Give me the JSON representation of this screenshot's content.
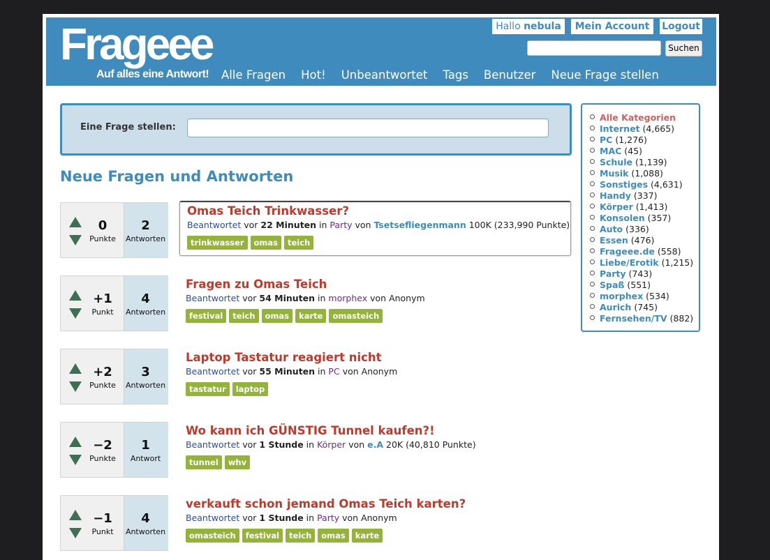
{
  "header": {
    "logo": "Frageee",
    "tagline": "Auf alles eine Antwort!",
    "greeting_prefix": "Hallo",
    "username": "nebula",
    "account_label": "Mein Account",
    "logout_label": "Logout",
    "search_button": "Suchen",
    "search_value": "",
    "nav": [
      "Alle Fragen",
      "Hot!",
      "Unbeantwortet",
      "Tags",
      "Benutzer",
      "Neue Frage stellen"
    ]
  },
  "ask": {
    "label": "Eine Frage stellen:",
    "value": ""
  },
  "section_title": "Neue Fragen und Antworten",
  "questions": [
    {
      "votes": "0",
      "votes_label": "Punkte",
      "answers": "2",
      "answers_label": "Antworten",
      "title": "Omas Teich Trinkwasser?",
      "status": "Beantwortet",
      "vor": "vor",
      "time": "22 Minuten",
      "in": "in",
      "category": "Party",
      "von": "von",
      "user": "Tsetsefliegenmann",
      "user_points": "100K (233,990 Punkte)",
      "tags": [
        "trinkwasser",
        "omas",
        "teich"
      ]
    },
    {
      "votes": "+1",
      "votes_label": "Punkt",
      "answers": "4",
      "answers_label": "Antworten",
      "title": "Fragen zu Omas Teich",
      "status": "Beantwortet",
      "vor": "vor",
      "time": "54 Minuten",
      "in": "in",
      "category": "morphex",
      "von": "von",
      "user": "",
      "user_points": "Anonym",
      "tags": [
        "festival",
        "teich",
        "omas",
        "karte",
        "omasteich"
      ]
    },
    {
      "votes": "+2",
      "votes_label": "Punkte",
      "answers": "3",
      "answers_label": "Antworten",
      "title": "Laptop Tastatur reagiert nicht",
      "status": "Beantwortet",
      "vor": "vor",
      "time": "55 Minuten",
      "in": "in",
      "category": "PC",
      "von": "von",
      "user": "",
      "user_points": "Anonym",
      "tags": [
        "tastatur",
        "laptop"
      ]
    },
    {
      "votes": "−2",
      "votes_label": "Punkte",
      "answers": "1",
      "answers_label": "Antwort",
      "title": "Wo kann ich GÜNSTIG Tunnel kaufen?!",
      "status": "Beantwortet",
      "vor": "vor",
      "time": "1 Stunde",
      "in": "in",
      "category": "Körper",
      "von": "von",
      "user": "e.A",
      "user_points": "20K (40,810 Punkte)",
      "tags": [
        "tunnel",
        "whv"
      ]
    },
    {
      "votes": "−1",
      "votes_label": "Punkt",
      "answers": "4",
      "answers_label": "Antworten",
      "title": "verkauft schon jemand Omas Teich karten?",
      "status": "Beantwortet",
      "vor": "vor",
      "time": "1 Stunde",
      "in": "in",
      "category": "Party",
      "von": "von",
      "user": "",
      "user_points": "Anonym",
      "tags": [
        "omasteich",
        "festival",
        "teich",
        "omas",
        "karte"
      ]
    }
  ],
  "categories": [
    {
      "name": "Alle Kategorien",
      "count": ""
    },
    {
      "name": "Internet",
      "count": "(4,665)"
    },
    {
      "name": "PC",
      "count": "(1,276)"
    },
    {
      "name": "MAC",
      "count": "(45)"
    },
    {
      "name": "Schule",
      "count": "(1,139)"
    },
    {
      "name": "Musik",
      "count": "(1,088)"
    },
    {
      "name": "Sonstiges",
      "count": "(4,631)"
    },
    {
      "name": "Handy",
      "count": "(337)"
    },
    {
      "name": "Körper",
      "count": "(1,413)"
    },
    {
      "name": "Konsolen",
      "count": "(357)"
    },
    {
      "name": "Auto",
      "count": "(336)"
    },
    {
      "name": "Essen",
      "count": "(476)"
    },
    {
      "name": "Frageee.de",
      "count": "(558)"
    },
    {
      "name": "Liebe/Erotik",
      "count": "(1,215)"
    },
    {
      "name": "Party",
      "count": "(743)"
    },
    {
      "name": "Spaß",
      "count": "(551)"
    },
    {
      "name": "morphex",
      "count": "(534)"
    },
    {
      "name": "Aurich",
      "count": "(745)"
    },
    {
      "name": "Fernsehen/TV",
      "count": "(882)"
    }
  ],
  "colors": {
    "brand": "#3f8bbd",
    "title": "#c0392b",
    "tag": "#93b33a",
    "vote_arrow": "#3f6e55"
  }
}
